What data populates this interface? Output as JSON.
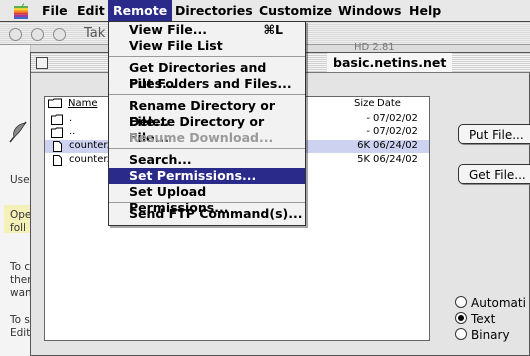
{
  "menubar": {
    "items": [
      "File",
      "Edit",
      "Remote",
      "Directories",
      "Customize",
      "Windows",
      "Help"
    ],
    "active": "Remote"
  },
  "background_window": {
    "title": "Tak",
    "title_right": "HD 2.81",
    "text_lines": [
      "Use",
      "Ope",
      "foll",
      "To c",
      "then",
      "want",
      "To s",
      "Edit"
    ]
  },
  "window": {
    "title": "basic.netins.net"
  },
  "file_list": {
    "columns": {
      "name": "Name",
      "size": "Size",
      "date": "Date"
    },
    "rows": [
      {
        "icon": "folder-icon",
        "name": ".",
        "size": "-",
        "date": "07/02/02"
      },
      {
        "icon": "folder-icon",
        "name": "..",
        "size": "-",
        "date": "07/02/02"
      },
      {
        "icon": "document-icon",
        "name": "counter.c",
        "size": "6K",
        "date": "06/24/02"
      },
      {
        "icon": "document-icon",
        "name": "counter.c",
        "size": "5K",
        "date": "06/24/02"
      }
    ]
  },
  "buttons": {
    "put_file": "Put File...",
    "get_file": "Get File..."
  },
  "transfer_mode": {
    "options": [
      "Automati",
      "Text",
      "Binary"
    ],
    "selected": "Text"
  },
  "remote_menu": {
    "items": [
      {
        "label": "View File...",
        "shortcut": "⌘L",
        "state": "enabled"
      },
      {
        "label": "View File List",
        "shortcut": "",
        "state": "enabled"
      },
      {
        "label": "Get Directories and Files...",
        "shortcut": "",
        "state": "enabled"
      },
      {
        "label": "Put Folders and Files...",
        "shortcut": "",
        "state": "enabled"
      },
      {
        "label": "Rename Directory or File...",
        "shortcut": "",
        "state": "enabled"
      },
      {
        "label": "Delete Directory or File...",
        "shortcut": "",
        "state": "enabled"
      },
      {
        "label": "Resume Download...",
        "shortcut": "",
        "state": "disabled"
      },
      {
        "label": "Search...",
        "shortcut": "",
        "state": "enabled"
      },
      {
        "label": "Set Permissions...",
        "shortcut": "",
        "state": "highlighted"
      },
      {
        "label": "Set Upload Permissions...",
        "shortcut": "",
        "state": "enabled"
      },
      {
        "label": "Send FTP Command(s)...",
        "shortcut": "",
        "state": "enabled"
      }
    ]
  },
  "colors": {
    "highlight": "#2a2a8a",
    "selected_row": "#cdd2f0"
  }
}
